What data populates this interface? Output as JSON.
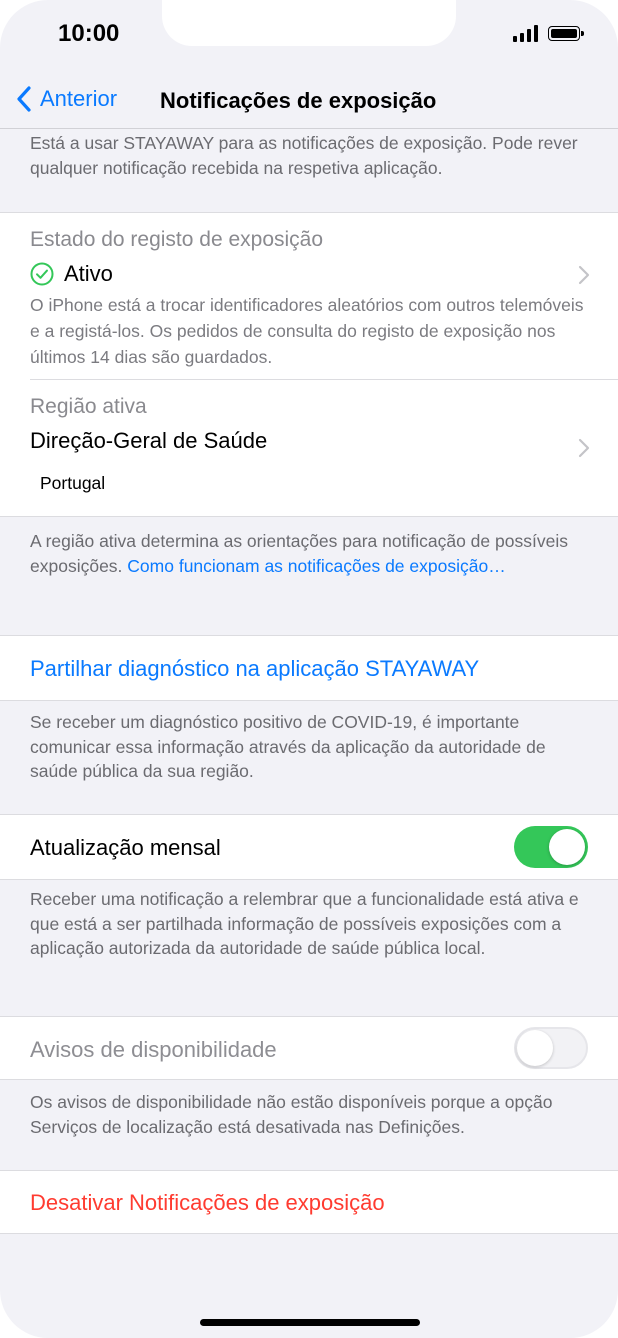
{
  "status_bar": {
    "time": "10:00"
  },
  "nav": {
    "back_label": "Anterior",
    "title": "Notificações de exposição"
  },
  "intro_text": "Está a usar STAYAWAY para as notificações de exposição. Pode rever qualquer notificação recebida na respetiva aplicação.",
  "exposure_status": {
    "heading": "Estado do registo de exposição",
    "status": "Ativo",
    "status_color": "#34c759",
    "description": "O iPhone está a trocar identificadores aleatórios com outros telemóveis e a registá-los. Os pedidos de consulta do registo de exposição nos últimos 14 dias são guardados."
  },
  "region": {
    "heading": "Região ativa",
    "authority": "Direção-Geral de Saúde",
    "country": "Portugal"
  },
  "region_footer": {
    "text": "A região ativa determina as orientações para notificação de possíveis exposições.",
    "link": "Como funcionam as notificações de exposição…"
  },
  "share_diagnosis": {
    "label": "Partilhar diagnóstico na aplicação STAYAWAY",
    "footer": "Se receber um diagnóstico positivo de COVID-19, é importante comunicar essa informação através da aplicação da autoridade de saúde pública da sua região."
  },
  "monthly_update": {
    "label": "Atualização mensal",
    "enabled": true,
    "footer": "Receber uma notificação a relembrar que a funcionalidade está ativa e que está a ser partilhada informação de possíveis exposições com a aplicação autorizada da autoridade de saúde pública local."
  },
  "availability_alerts": {
    "label": "Avisos de disponibilidade",
    "enabled": false,
    "footer": "Os avisos de disponibilidade não estão disponíveis porque a opção Serviços de localização está desativada nas Definições."
  },
  "disable_button": {
    "label": "Desativar Notificações de exposição",
    "color": "#ff3b30"
  },
  "colors": {
    "accent": "#0a7aff",
    "toggle_on": "#34c759",
    "background": "#f2f2f7"
  }
}
